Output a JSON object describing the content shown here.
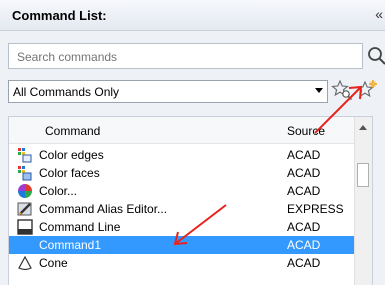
{
  "panel": {
    "title": "Command List:",
    "pin_glyph": "«"
  },
  "search": {
    "placeholder": "Search commands",
    "icon": "search-icon"
  },
  "filter": {
    "selected": "All Commands Only",
    "icons": [
      "filter-commands-icon",
      "create-command-icon"
    ]
  },
  "columns": {
    "command": "Command",
    "source": "Source"
  },
  "rows": [
    {
      "name": "Color edges",
      "source": "ACAD",
      "icon": "color-edges-icon",
      "selected": false
    },
    {
      "name": "Color faces",
      "source": "ACAD",
      "icon": "color-faces-icon",
      "selected": false
    },
    {
      "name": "Color...",
      "source": "ACAD",
      "icon": "color-wheel-icon",
      "selected": false
    },
    {
      "name": "Command Alias Editor...",
      "source": "EXPRESS",
      "icon": "alias-editor-icon",
      "selected": false
    },
    {
      "name": "Command Line",
      "source": "ACAD",
      "icon": "command-line-icon",
      "selected": false
    },
    {
      "name": "Command1",
      "source": "ACAD",
      "icon": "",
      "selected": true
    },
    {
      "name": "Cone",
      "source": "ACAD",
      "icon": "cone-icon",
      "selected": false
    }
  ],
  "colors": {
    "selection": "#3399ff",
    "annotation_arrow": "#e8231c"
  }
}
